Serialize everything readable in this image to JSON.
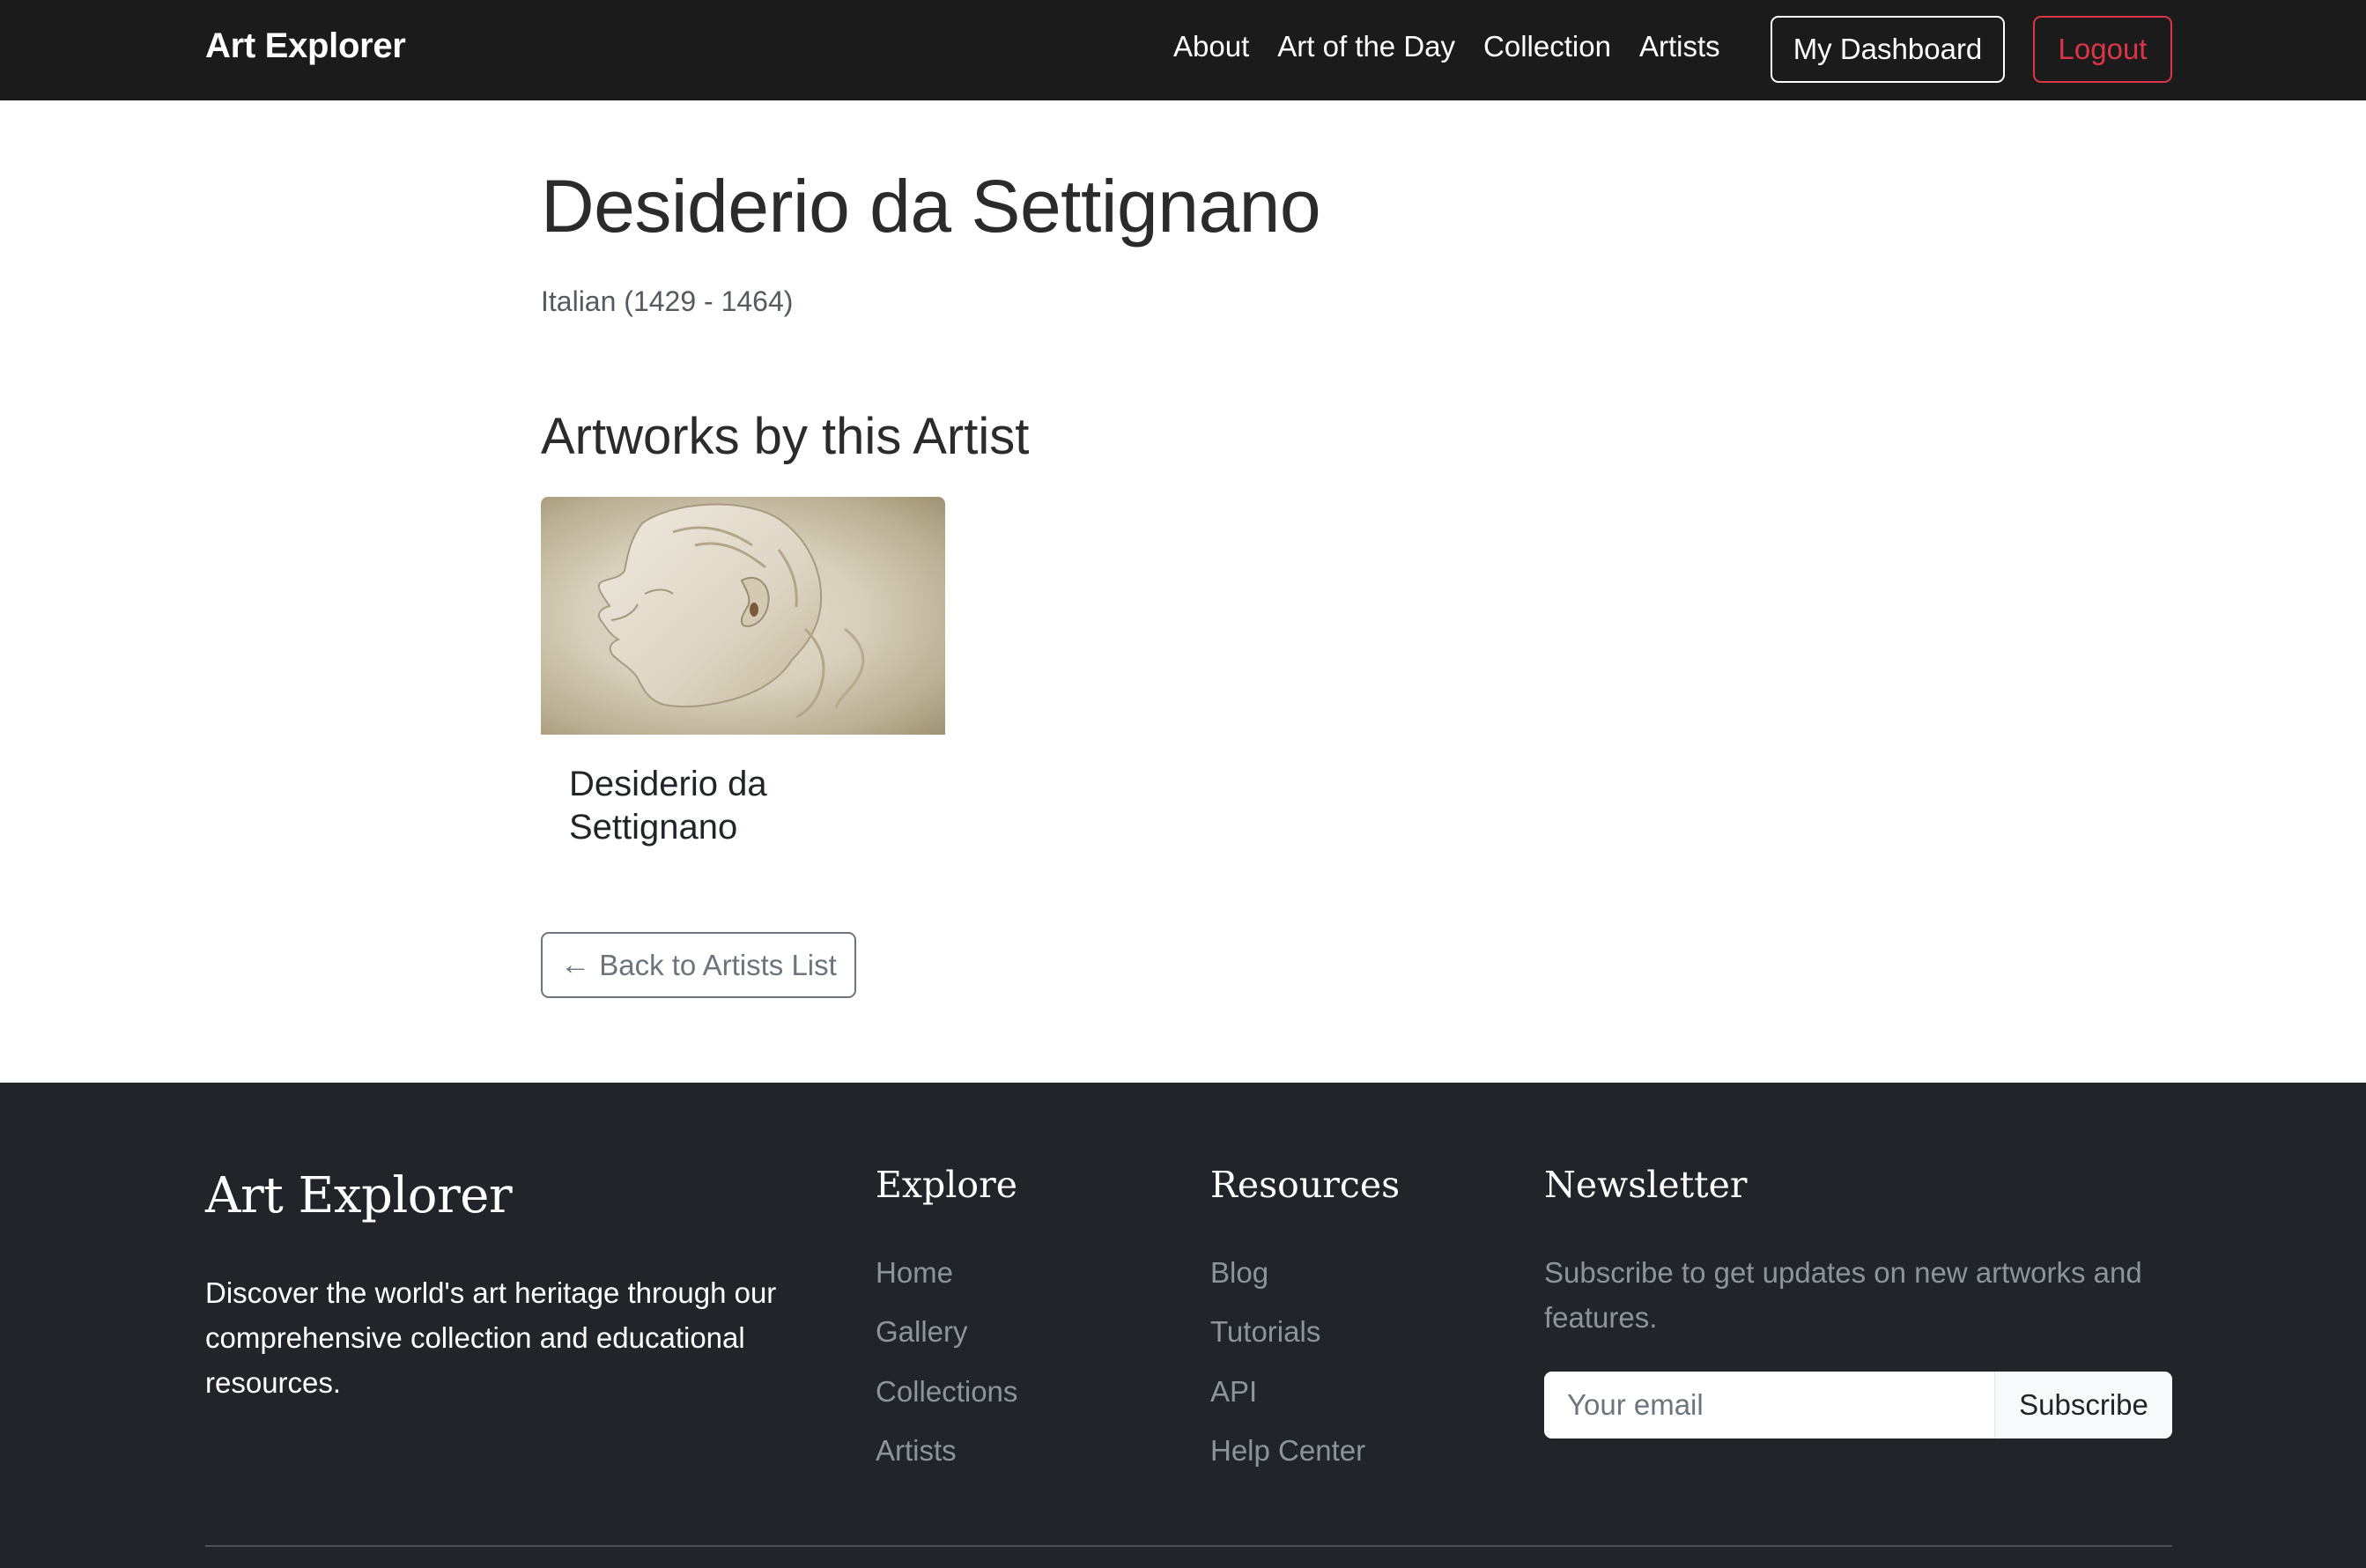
{
  "nav": {
    "brand": "Art Explorer",
    "links": [
      "About",
      "Art of the Day",
      "Collection",
      "Artists"
    ],
    "dashboard_label": "My Dashboard",
    "logout_label": "Logout"
  },
  "artist": {
    "name": "Desiderio da Settignano",
    "meta": "Italian (1429 - 1464)"
  },
  "artworks": {
    "heading": "Artworks by this Artist",
    "items": [
      {
        "title": "Desiderio da Settignano"
      }
    ]
  },
  "back_button": {
    "label": "Back to Artists List",
    "icon": "arrow-left-icon"
  },
  "footer": {
    "brand": "Art Explorer",
    "description": "Discover the world's art heritage through our comprehensive collection and educational resources.",
    "explore": {
      "heading": "Explore",
      "links": [
        "Home",
        "Gallery",
        "Collections",
        "Artists"
      ]
    },
    "resources": {
      "heading": "Resources",
      "links": [
        "Blog",
        "Tutorials",
        "API",
        "Help Center"
      ]
    },
    "newsletter": {
      "heading": "Newsletter",
      "text": "Subscribe to get updates on new artworks and features.",
      "email_placeholder": "Your email",
      "subscribe_label": "Subscribe"
    }
  },
  "colors": {
    "navbar_bg": "#1b1b1c",
    "footer_bg": "#212529",
    "danger": "#dc3545",
    "secondary": "#6c757d"
  }
}
